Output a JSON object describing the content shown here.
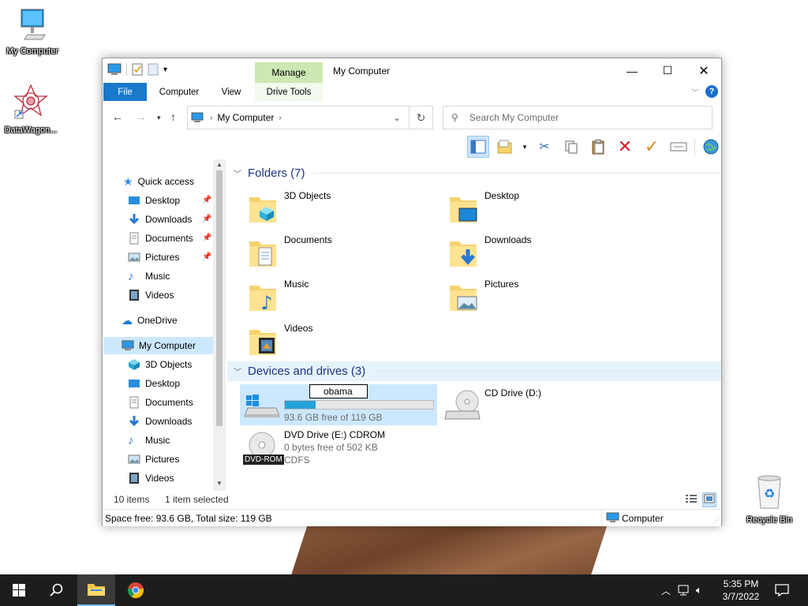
{
  "desktop": {
    "icons": [
      {
        "label": "My Computer"
      },
      {
        "label": "DataWagon..."
      },
      {
        "label": "Recycle Bin"
      }
    ]
  },
  "window": {
    "title": "My Computer",
    "manage_tab": "Manage",
    "tabs": [
      "File",
      "Computer",
      "View",
      "Drive Tools"
    ],
    "address": "My Computer",
    "search_placeholder": "Search My Computer",
    "controls": {
      "minimize": "—",
      "maximize": "☐",
      "close": "✕"
    }
  },
  "nav": {
    "quick_access": "Quick access",
    "quick_items": [
      {
        "label": "Desktop",
        "pinned": true
      },
      {
        "label": "Downloads",
        "pinned": true
      },
      {
        "label": "Documents",
        "pinned": true
      },
      {
        "label": "Pictures",
        "pinned": true
      },
      {
        "label": "Music",
        "pinned": false
      },
      {
        "label": "Videos",
        "pinned": false
      }
    ],
    "onedrive": "OneDrive",
    "my_computer": "My Computer",
    "pc_items": [
      "3D Objects",
      "Desktop",
      "Documents",
      "Downloads",
      "Music",
      "Pictures",
      "Videos"
    ]
  },
  "content": {
    "folders_header": "Folders (7)",
    "folders": [
      "3D Objects",
      "Desktop",
      "Documents",
      "Downloads",
      "Music",
      "Pictures",
      "Videos"
    ],
    "devices_header": "Devices and drives (3)",
    "drive_c": {
      "rename_value": "obama",
      "free": "93.6 GB free of 119 GB",
      "used_fraction": 0.21
    },
    "drive_d": {
      "name": "CD Drive (D:)"
    },
    "drive_e": {
      "name": "DVD Drive (E:) CDROM",
      "free": "0 bytes free of 502 KB",
      "fs": "CDFS",
      "badge": "DVD-ROM"
    }
  },
  "status": {
    "items": "10 items",
    "selected": "1 item selected",
    "space": "Space free: 93.6 GB, Total size: 119 GB",
    "location": "Computer"
  },
  "taskbar": {
    "time": "5:35 PM",
    "date": "3/7/2022"
  }
}
